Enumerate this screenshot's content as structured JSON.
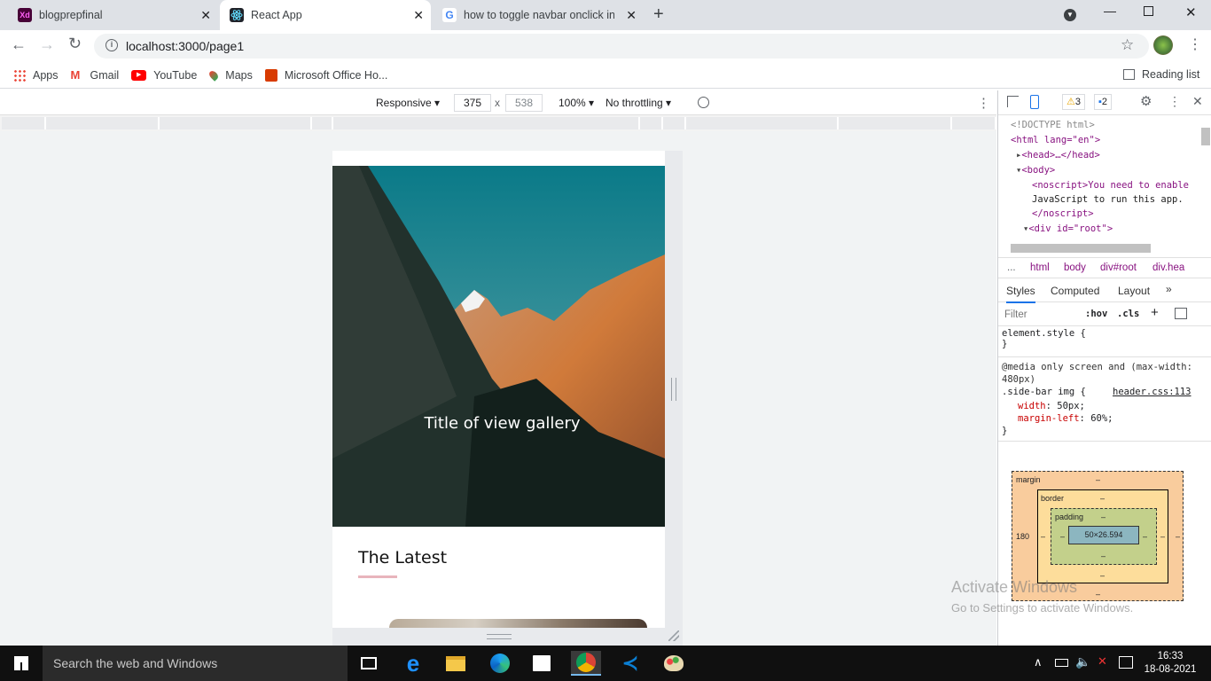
{
  "tabs": [
    {
      "title": "blogprepfinal",
      "icon": "xd-icon"
    },
    {
      "title": "React App",
      "icon": "react-icon"
    },
    {
      "title": "how to toggle navbar onclick in r",
      "icon": "google-icon"
    }
  ],
  "address": {
    "url": "localhost:3000/page1"
  },
  "bookmarks": [
    {
      "label": "Apps",
      "icon": "apps-grid-icon"
    },
    {
      "label": "Gmail",
      "icon": "gmail-icon"
    },
    {
      "label": "YouTube",
      "icon": "youtube-icon"
    },
    {
      "label": "Maps",
      "icon": "maps-icon"
    },
    {
      "label": "Microsoft Office Ho...",
      "icon": "office-icon"
    }
  ],
  "reading_list": "Reading list",
  "device_toolbar": {
    "mode": "Responsive",
    "width": "375",
    "times": "x",
    "height": "538",
    "zoom": "100%",
    "throttling": "No throttling"
  },
  "page": {
    "hero_title": "Title of view gallery",
    "section_title": "The Latest",
    "accent": "#e8b4bc"
  },
  "devtools": {
    "warnings": "3",
    "messages": "2",
    "dom": [
      "<!DOCTYPE html>",
      "<html lang=\"en\">",
      "<head>…</head>",
      "<body>",
      "<noscript>You need to enable",
      "JavaScript to run this app.",
      "</noscript>",
      "<div id=\"root\">"
    ],
    "breadcrumbs": [
      "...",
      "html",
      "body",
      "div#root",
      "div.hea"
    ],
    "panel_tabs": [
      "Styles",
      "Computed",
      "Layout"
    ],
    "filter_placeholder": "Filter",
    "hov": ":hov",
    "cls": ".cls",
    "element_style": "element.style {",
    "close_brace": "}",
    "media_rule": "@media only screen and (max-width: 480px)",
    "selector": ".side-bar img {",
    "source": "header.css:113",
    "decl1_prop": "width",
    "decl1_val": "50px;",
    "decl2_prop": "margin-left",
    "decl2_val": "60%;",
    "boxmodel": {
      "margin": "margin",
      "border": "border",
      "padding": "padding",
      "content": "50×26.594",
      "left_margin": "180",
      "dash": "–"
    }
  },
  "watermark": {
    "line1": "Activate Windows",
    "line2": "Go to Settings to activate Windows."
  },
  "taskbar": {
    "search": "Search the web and Windows",
    "time": "16:33",
    "date": "18-08-2021"
  }
}
